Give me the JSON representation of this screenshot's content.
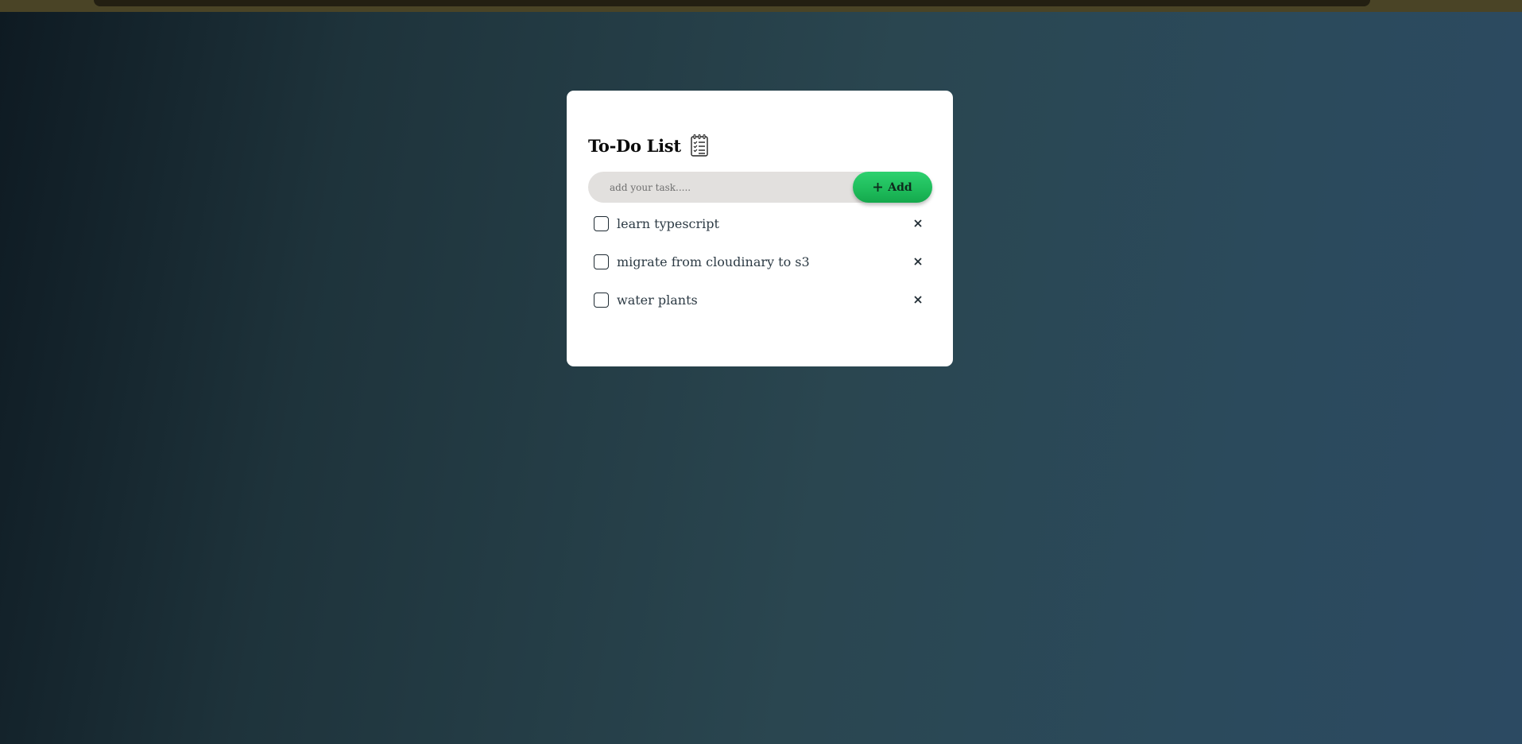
{
  "app": {
    "title": "To-Do List",
    "title_icon": "notepad-icon"
  },
  "input": {
    "placeholder": "add your task.....",
    "value": ""
  },
  "add_button": {
    "label": "Add",
    "icon": "plus-icon"
  },
  "tasks": [
    {
      "text": "learn typescript",
      "checked": false,
      "delete_icon": "close-icon"
    },
    {
      "text": "migrate from cloudinary to s3",
      "checked": false,
      "delete_icon": "close-icon"
    },
    {
      "text": "water plants",
      "checked": false,
      "delete_icon": "close-icon"
    }
  ],
  "colors": {
    "accent": "#1fbd5c",
    "card": "#ffffff",
    "input_bg": "#e2e0de",
    "text": "#2c3a44"
  }
}
